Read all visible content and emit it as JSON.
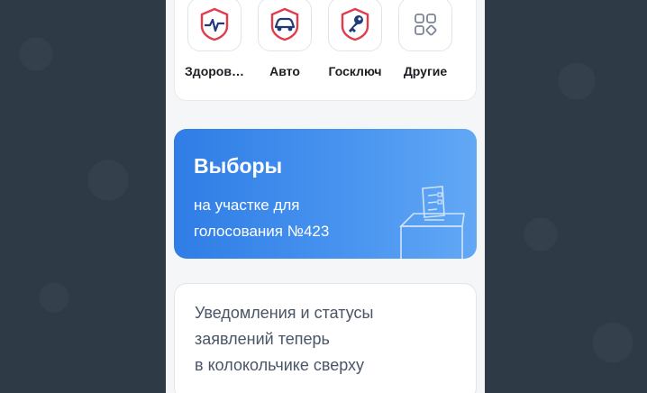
{
  "services": [
    {
      "label": "Здоров…",
      "icon": "health-heartbeat-icon"
    },
    {
      "label": "Авто",
      "icon": "car-icon"
    },
    {
      "label": "Госключ",
      "icon": "key-icon"
    },
    {
      "label": "Другие",
      "icon": "grid-apps-icon"
    }
  ],
  "election": {
    "title": "Выборы",
    "subtitle": "на участке для голосования №423",
    "icon": "ballot-box-icon"
  },
  "notice": {
    "lines": [
      "Уведомления и статусы",
      "заявлений теперь",
      "в колокольчике сверху"
    ]
  },
  "colors": {
    "accent_blue": "#2f7de6",
    "accent_red": "#e23b4a",
    "icon_navy": "#1f3a7a"
  }
}
